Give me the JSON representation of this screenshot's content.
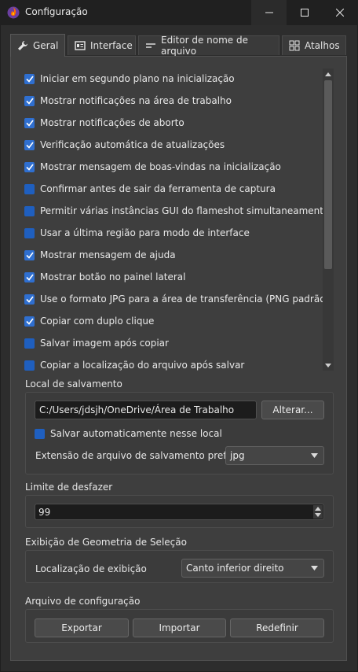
{
  "window": {
    "title": "Configuração"
  },
  "tabs": [
    {
      "label": "Geral",
      "icon": "wrench-icon",
      "active": true
    },
    {
      "label": "Interface",
      "icon": "interface-icon",
      "active": false
    },
    {
      "label": "Editor de nome de arquivo",
      "icon": "text-editor-icon",
      "active": false
    },
    {
      "label": "Atalhos",
      "icon": "shortcuts-grid-icon",
      "active": false
    }
  ],
  "options": [
    {
      "label": "Iniciar em segundo plano na inicialização",
      "checked": true
    },
    {
      "label": "Mostrar notificações na área de trabalho",
      "checked": true
    },
    {
      "label": "Mostrar notificações de aborto",
      "checked": true
    },
    {
      "label": "Verificação automática de atualizações",
      "checked": true
    },
    {
      "label": "Mostrar mensagem de boas-vindas na inicialização",
      "checked": true
    },
    {
      "label": "Confirmar antes de sair da ferramenta de captura",
      "checked": false
    },
    {
      "label": "Permitir várias instâncias GUI do flameshot simultaneamente",
      "checked": false
    },
    {
      "label": "Usar a última região para modo de interface",
      "checked": false
    },
    {
      "label": "Mostrar mensagem de ajuda",
      "checked": true
    },
    {
      "label": "Mostrar botão no painel lateral",
      "checked": true
    },
    {
      "label": "Use o formato JPG para a área de transferência (PNG padrão)",
      "checked": true
    },
    {
      "label": "Copiar com duplo clique",
      "checked": true
    },
    {
      "label": "Salvar imagem após copiar",
      "checked": false
    },
    {
      "label": "Copiar a localização do arquivo após salvar",
      "checked": false
    }
  ],
  "save_location": {
    "title": "Local de salvamento",
    "path": "C:/Users/jdsjh/OneDrive/Área de Trabalho",
    "change_button": "Alterar...",
    "auto_save_label": "Salvar automaticamente nesse local",
    "auto_save_checked": false,
    "extension_label": "Extensão de arquivo de salvamento preferida:",
    "extension_value": "jpg"
  },
  "undo": {
    "title": "Limite de desfazer",
    "value": "99"
  },
  "geometry": {
    "title": "Exibição de Geometria de Seleção",
    "location_label": "Localização de exibição",
    "location_value": "Canto inferior direito"
  },
  "config_file": {
    "title": "Arquivo de configuração",
    "export_button": "Exportar",
    "import_button": "Importar",
    "reset_button": "Redefinir"
  },
  "colors": {
    "accent": "#2f6fd0",
    "background": "#3e3e3e"
  }
}
